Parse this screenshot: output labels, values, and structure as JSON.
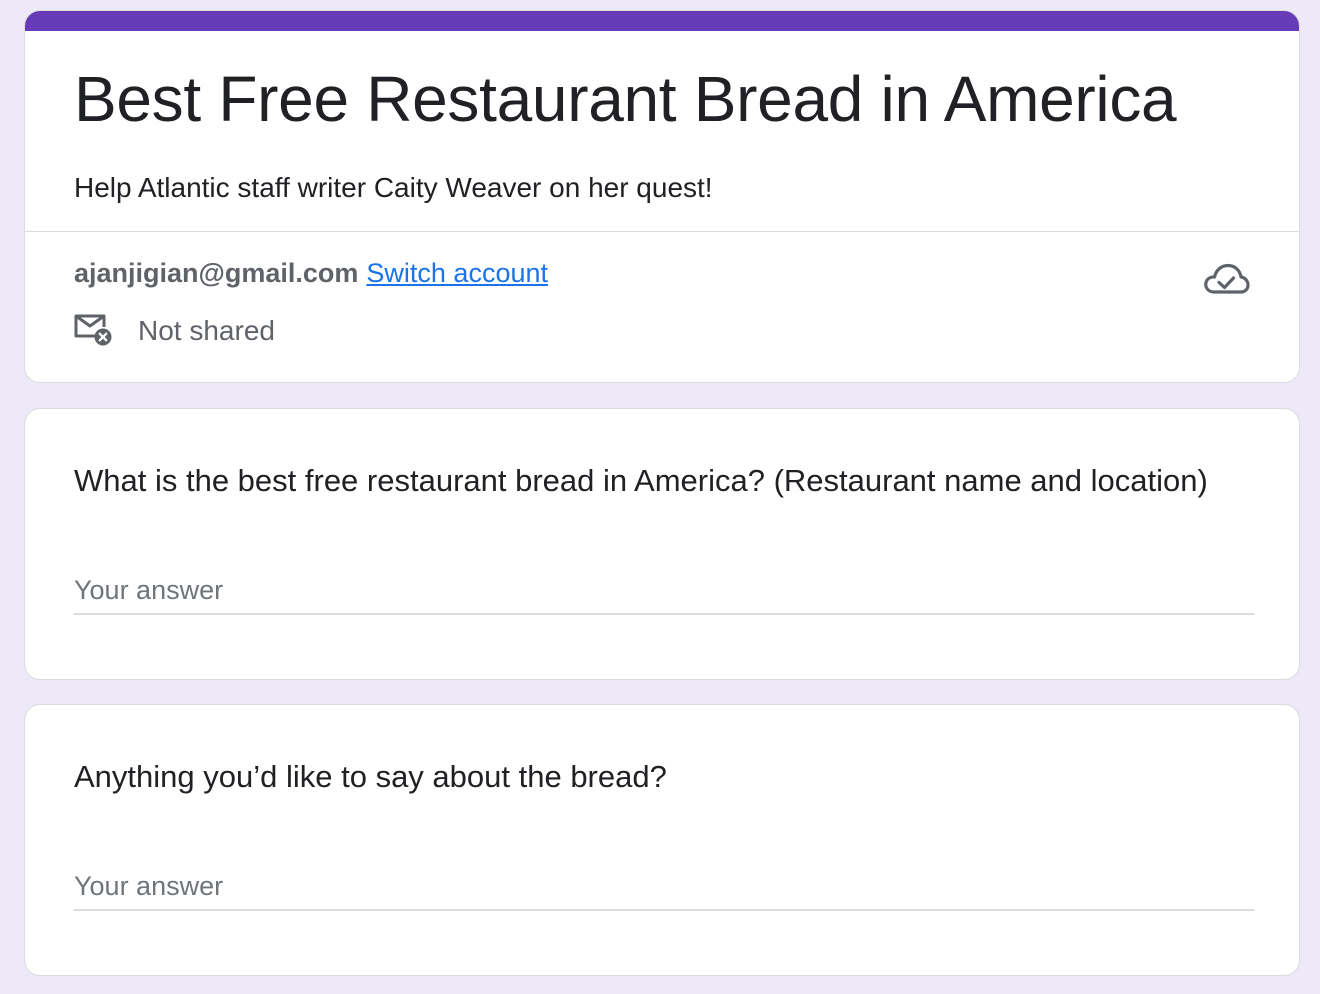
{
  "form": {
    "title": "Best Free Restaurant Bread in America",
    "description": "Help Atlantic staff writer Caity Weaver on her quest!",
    "accent_color": "#673ab7"
  },
  "account": {
    "email": "ajanjigian@gmail.com",
    "switch_label": "Switch account",
    "sharing_status": "Not shared",
    "sharing_icon": "mail-not-shared-icon",
    "sync_icon": "cloud-done-icon"
  },
  "questions": [
    {
      "title": "What is the best free restaurant bread in America? (Restaurant name and location)",
      "placeholder": "Your answer",
      "value": ""
    },
    {
      "title": "Anything you’d like to say about the bread?",
      "placeholder": "Your answer",
      "value": ""
    }
  ],
  "colors": {
    "page_background": "#ede9f6",
    "link": "#1a73e8"
  }
}
